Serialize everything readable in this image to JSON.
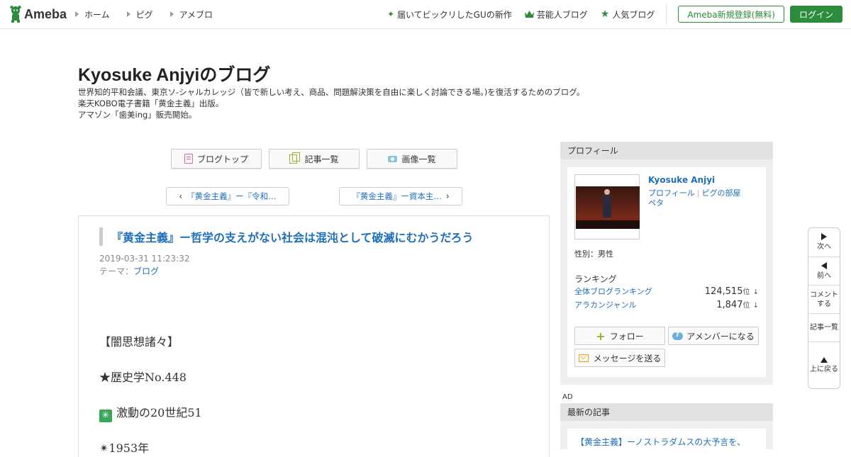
{
  "header": {
    "logo_text": "Ameba",
    "nav": [
      "ホーム",
      "ピグ",
      "アメブロ"
    ],
    "links": [
      {
        "label": "届いてビックリしたGUの新作",
        "icon": "sparkle-icon"
      },
      {
        "label": "芸能人ブログ",
        "icon": "crown-icon"
      },
      {
        "label": "人気ブログ",
        "icon": "star-icon"
      }
    ],
    "register_label": "Ameba新規登録(無料)",
    "login_label": "ログイン",
    "accent_color": "#2d8c3c"
  },
  "blog": {
    "title": "Kyosuke Anjyiのブログ",
    "description": [
      "世界知的平和会議、東京ソ-シャルカレッジ（皆で新しい考え、商品、問題解決策を自由に楽しく討論できる場。)を復活するためのブログ。",
      "楽天KOBO電子書籍「黄金主義」出版。",
      "アマゾン「歯美ing」販売開始。"
    ]
  },
  "menu": {
    "blog_top": "ブログトップ",
    "articles": "記事一覧",
    "images": "画像一覧"
  },
  "pager": {
    "prev": "『黄金主義』ー『令和…",
    "next": "『黄金主義』ー資本主…"
  },
  "article": {
    "title": "『黄金主義』ー哲学の支えがない社会は混沌として破滅にむかうだろう",
    "date": "2019-03-31 11:23:32",
    "theme_label": "テーマ：",
    "theme_value": "ブログ",
    "body": {
      "line1": "【闇思想諸々】",
      "line2": "★歴史学No.448",
      "line3_icon": "✳",
      "line3": "激動の20世紀51",
      "line4": "✴1953年"
    }
  },
  "sidebar": {
    "profile_header": "プロフィール",
    "name": "Kyosuke Anjyi",
    "link_profile": "プロフィール",
    "link_pigg": "ピグの部屋",
    "link_peta": "ペタ",
    "gender": "性別：男性",
    "ranking_title": "ランキング",
    "rankings": [
      {
        "label": "全体ブログランキング",
        "value": "124,515",
        "unit": "位",
        "trend": "↓"
      },
      {
        "label": "アラカンジャンル",
        "value": "1,847",
        "unit": "位",
        "trend": "↓"
      }
    ],
    "follow": "フォロー",
    "amember": "アメンバーになる",
    "message": "メッセージを送る",
    "ad": "AD",
    "latest_header": "最新の記事",
    "latest_item": "【黄金主義】ーノストラダムスの大予言を、"
  },
  "float_nav": {
    "next": "次へ",
    "prev": "前へ",
    "comment_1": "コメント",
    "comment_2": "する",
    "articles": "記事一覧",
    "top": "上に戻る"
  }
}
